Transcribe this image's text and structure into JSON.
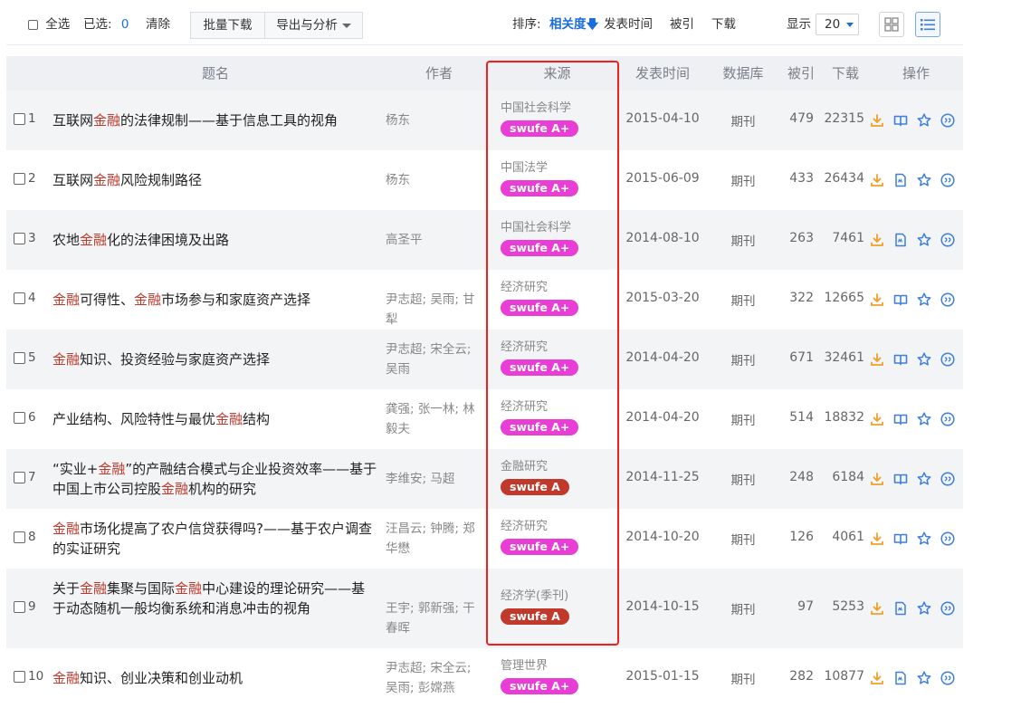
{
  "toolbar": {
    "select_all": "全选",
    "selected_label": "已选:",
    "selected_count": "0",
    "clear": "清除",
    "batch_download": "批量下载",
    "export_analyze": "导出与分析",
    "sort_label": "排序:",
    "sort_relevance": "相关度",
    "sort_date": "发表时间",
    "sort_cited": "被引",
    "sort_download": "下载",
    "display_label": "显示",
    "page_size": "20"
  },
  "table": {
    "headers": [
      "题名",
      "作者",
      "来源",
      "发表时间",
      "数据库",
      "被引",
      "下载",
      "操作"
    ],
    "rows": [
      {
        "no": "1",
        "title_html": "互联网<em>金融</em>的法律规制——基于信息工具的视角",
        "author": "杨东",
        "source": "中国社会科学",
        "badge": "swufe A+",
        "date": "2015-04-10",
        "db": "期刊",
        "cited": "479",
        "downloads": "22315"
      },
      {
        "no": "2",
        "title_html": "互联网<em>金融</em>风险规制路径",
        "author": "杨东",
        "source": "中国法学",
        "badge": "swufe A+",
        "date": "2015-06-09",
        "db": "期刊",
        "cited": "433",
        "downloads": "26434"
      },
      {
        "no": "3",
        "title_html": "农地<em>金融</em>化的法律困境及出路",
        "author": "高圣平",
        "source": "中国社会科学",
        "badge": "swufe A+",
        "date": "2014-08-10",
        "db": "期刊",
        "cited": "263",
        "downloads": "7461"
      },
      {
        "no": "4",
        "title_html": "<em>金融</em>可得性、<em>金融</em>市场参与和家庭资产选择",
        "author": "尹志超; 吴雨; 甘犁",
        "source": "经济研究",
        "badge": "swufe A+",
        "date": "2015-03-20",
        "db": "期刊",
        "cited": "322",
        "downloads": "12665"
      },
      {
        "no": "5",
        "title_html": "<em>金融</em>知识、投资经验与家庭资产选择",
        "author": "尹志超; 宋全云; 吴雨",
        "source": "经济研究",
        "badge": "swufe A+",
        "date": "2014-04-20",
        "db": "期刊",
        "cited": "671",
        "downloads": "32461"
      },
      {
        "no": "6",
        "title_html": "产业结构、风险特性与最优<em>金融</em>结构",
        "author": "龚强; 张一林; 林毅夫",
        "source": "经济研究",
        "badge": "swufe A+",
        "date": "2014-04-20",
        "db": "期刊",
        "cited": "514",
        "downloads": "18832"
      },
      {
        "no": "7",
        "title_html": "“实业+<em>金融</em>”的产融结合模式与企业投资效率——基于中国上市公司控股<em>金融</em>机构的研究",
        "author": "李维安; 马超",
        "source": "金融研究",
        "badge": "swufe A",
        "date": "2014-11-25",
        "db": "期刊",
        "cited": "248",
        "downloads": "6184"
      },
      {
        "no": "8",
        "title_html": "<em>金融</em>市场化提高了农户信贷获得吗?——基于农户调查的实证研究",
        "author": "汪昌云; 钟腾; 郑华懋",
        "source": "经济研究",
        "badge": "swufe A+",
        "date": "2014-10-20",
        "db": "期刊",
        "cited": "126",
        "downloads": "4061"
      },
      {
        "no": "9",
        "title_html": "关于<em>金融</em>集聚与国际<em>金融</em>中心建设的理论研究——基于动态随机一般均衡系统和消息冲击的视角",
        "author": "王宇; 郭新强; 干春晖",
        "source": "经济学(季刊)",
        "badge": "swufe A",
        "date": "2014-10-15",
        "db": "期刊",
        "cited": "97",
        "downloads": "5253"
      },
      {
        "no": "10",
        "title_html": "<em>金融</em>知识、创业决策和创业动机",
        "author": "尹志超; 宋全云; 吴雨; 彭嫦燕",
        "source": "管理世界",
        "badge": "swufe A+",
        "date": "2015-01-15",
        "db": "期刊",
        "cited": "282",
        "downloads": "10877"
      }
    ]
  },
  "colors": {
    "badge_a_plus": "#e83ed6",
    "badge_a": "#c0392b",
    "highlight": "#f0201f",
    "accent": "#1a6ee0",
    "icon_download": "#f0a02a",
    "icon_read": "#3f7fd9"
  }
}
